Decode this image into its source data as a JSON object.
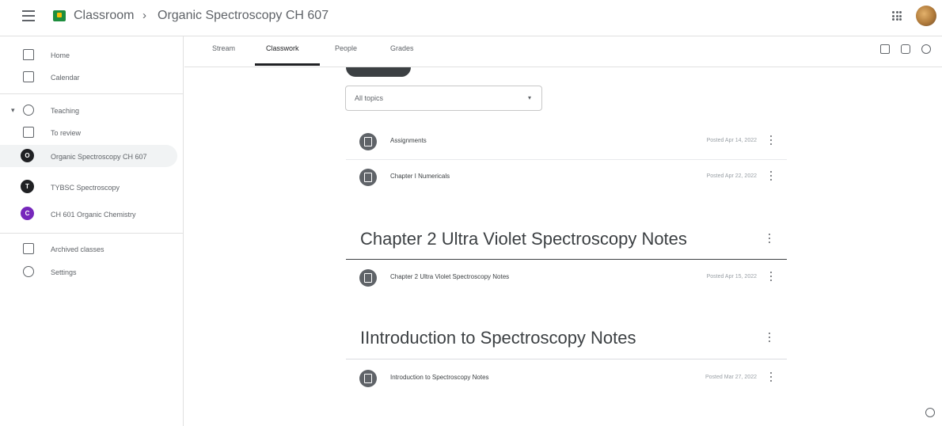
{
  "header": {
    "root": "Classroom",
    "separator": "›",
    "class_name": "Organic Spectroscopy CH 607"
  },
  "sidebar": {
    "items": [
      {
        "label": "Home",
        "icon": "home-icon"
      },
      {
        "label": "Calendar",
        "icon": "calendar-icon"
      },
      {
        "label": "Teaching",
        "icon": "people-icon"
      },
      {
        "label": "To review",
        "icon": "folder-icon"
      },
      {
        "label": "Organic Spectroscopy CH 607",
        "badge": "O",
        "badge_color": "#202124"
      },
      {
        "label": "TYBSC Spectroscopy",
        "badge": "T",
        "badge_color": "#202124"
      },
      {
        "label": "CH 601 Organic Chemistry",
        "badge": "C",
        "badge_color": "#7627bb"
      },
      {
        "label": "Archived classes",
        "icon": "archive-icon"
      },
      {
        "label": "Settings",
        "icon": "gear-icon"
      }
    ]
  },
  "tabs": [
    {
      "label": "Stream"
    },
    {
      "label": "Classwork",
      "active": true
    },
    {
      "label": "People"
    },
    {
      "label": "Grades"
    }
  ],
  "filter": {
    "selected": "All topics"
  },
  "topics": {
    "unnamed": {
      "items": [
        {
          "title": "Assignments",
          "date": "Posted Apr 14, 2022"
        },
        {
          "title": "Chapter I Numericals",
          "date": "Posted Apr 22, 2022"
        }
      ]
    },
    "chapter2": {
      "heading": "Chapter 2 Ultra Violet Spectroscopy Notes",
      "items": [
        {
          "title": "Chapter 2 Ultra Violet Spectroscopy Notes",
          "date": "Posted Apr 15, 2022"
        }
      ]
    },
    "intro": {
      "heading": "IIntroduction to Spectroscopy Notes",
      "items": [
        {
          "title": "Introduction to Spectroscopy Notes",
          "date": "Posted Mar 27, 2022"
        }
      ]
    }
  },
  "colors": {
    "accent": "#202124",
    "logo": "#1e8e3e",
    "purple_badge": "#7627bb"
  }
}
